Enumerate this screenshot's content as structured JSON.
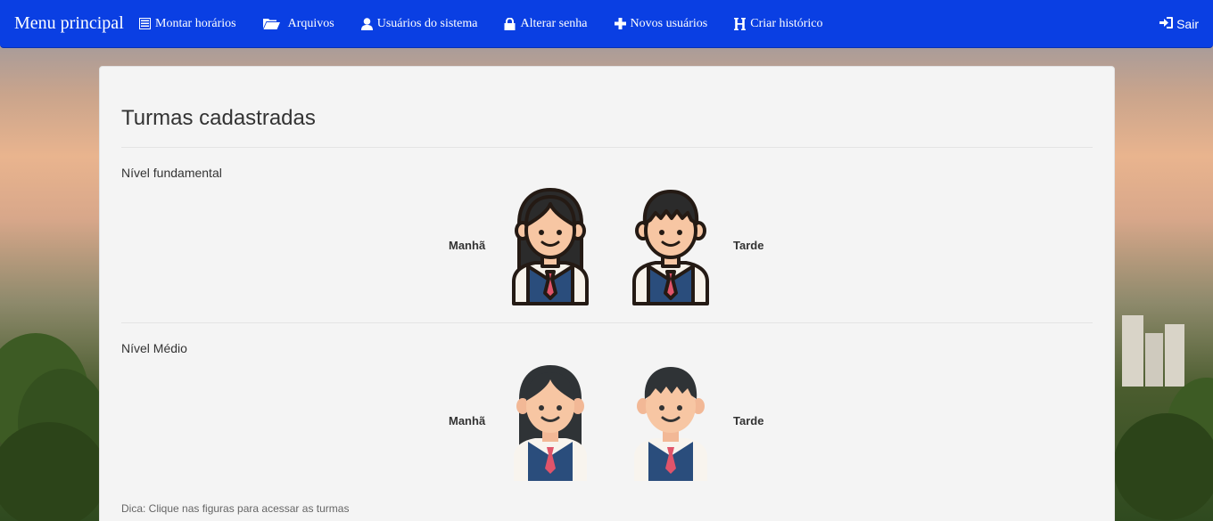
{
  "navbar": {
    "brand": "Menu principal",
    "items": [
      {
        "label": "Montar horários",
        "icon": "list-icon"
      },
      {
        "label": "Arquivos",
        "icon": "folder-open-icon"
      },
      {
        "label": "Usuários do sistema",
        "icon": "user-icon"
      },
      {
        "label": "Alterar senha",
        "icon": "lock-icon"
      },
      {
        "label": "Novos usuários",
        "icon": "plus-icon"
      },
      {
        "label": "Criar histórico",
        "icon": "header-h-icon"
      }
    ],
    "logout": {
      "label": "Sair",
      "icon": "log-in-icon"
    }
  },
  "main": {
    "title": "Turmas cadastradas",
    "levels": [
      {
        "label": "Nível fundamental",
        "left_shift": "Manhã",
        "right_shift": "Tarde",
        "style": "outlined"
      },
      {
        "label": "Nível Médio",
        "left_shift": "Manhã",
        "right_shift": "Tarde",
        "style": "flat"
      }
    ],
    "hint": "Dica: Clique nas figuras para acessar as turmas"
  },
  "colors": {
    "navbar": "#0a3fe3",
    "panel": "#f4f4f4",
    "vest": "#2a4d7c",
    "tie": "#e0546a",
    "skin": "#f7c6a3",
    "hair": "#2b2b2b"
  }
}
